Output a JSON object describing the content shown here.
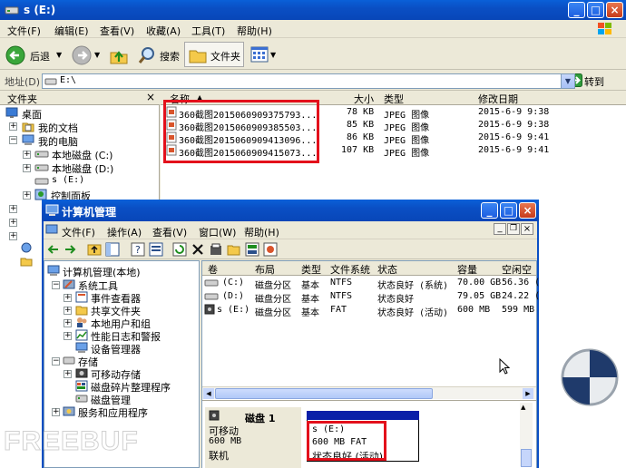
{
  "explorer": {
    "title": "s (E:)",
    "menu": [
      "文件(F)",
      "编辑(E)",
      "查看(V)",
      "收藏(A)",
      "工具(T)",
      "帮助(H)"
    ],
    "toolbar": {
      "back": "后退",
      "search": "搜索",
      "folders": "文件夹"
    },
    "address": {
      "label": "地址(D)",
      "value": "E:\\",
      "go": "转到"
    },
    "folders_pane": {
      "title": "文件夹",
      "close": "×"
    },
    "tree": [
      "桌面",
      "我的文档",
      "我的电脑",
      "本地磁盘 (C:)",
      "本地磁盘 (D:)",
      "s (E:)",
      "控制面板"
    ],
    "columns": {
      "name": "名称",
      "size": "大小",
      "type": "类型",
      "date": "修改日期"
    },
    "files": [
      {
        "name": "360截图2015060909375793...",
        "size": "78 KB",
        "type": "JPEG 图像",
        "date": "2015-6-9 9:38"
      },
      {
        "name": "360截图2015060909385503...",
        "size": "85 KB",
        "type": "JPEG 图像",
        "date": "2015-6-9 9:38"
      },
      {
        "name": "360截图2015060909413096...",
        "size": "86 KB",
        "type": "JPEG 图像",
        "date": "2015-6-9 9:41"
      },
      {
        "name": "360截图2015060909415073...",
        "size": "107 KB",
        "type": "JPEG 图像",
        "date": "2015-6-9 9:41"
      }
    ]
  },
  "cm": {
    "title": "计算机管理",
    "menu": [
      "文件(F)",
      "操作(A)",
      "查看(V)",
      "窗口(W)",
      "帮助(H)"
    ],
    "tree": [
      "计算机管理(本地)",
      "系统工具",
      "事件查看器",
      "共享文件夹",
      "本地用户和组",
      "性能日志和警报",
      "设备管理器",
      "存储",
      "可移动存储",
      "磁盘碎片整理程序",
      "磁盘管理",
      "服务和应用程序"
    ],
    "columns": [
      "卷",
      "布局",
      "类型",
      "文件系统",
      "状态",
      "容量",
      "空闲空"
    ],
    "volumes": [
      {
        "vol": "(C:)",
        "layout": "磁盘分区",
        "type": "基本",
        "fs": "NTFS",
        "status": "状态良好 (系统)",
        "cap": "70.00 GB",
        "free": "56.36 ("
      },
      {
        "vol": "(D:)",
        "layout": "磁盘分区",
        "type": "基本",
        "fs": "NTFS",
        "status": "状态良好",
        "cap": "79.05 GB",
        "free": "24.22 ("
      },
      {
        "vol": "s (E:)",
        "layout": "磁盘分区",
        "type": "基本",
        "fs": "FAT",
        "status": "状态良好 (活动)",
        "cap": "600 MB",
        "free": "599 MB"
      }
    ],
    "disk": {
      "name": "磁盘 1",
      "kind": "可移动",
      "size": "600 MB",
      "state": "联机"
    },
    "partition": {
      "name": "s  (E:)",
      "size_fs": "600 MB FAT",
      "status": "状态良好 (活动)"
    }
  },
  "watermark": "FREEBUF"
}
